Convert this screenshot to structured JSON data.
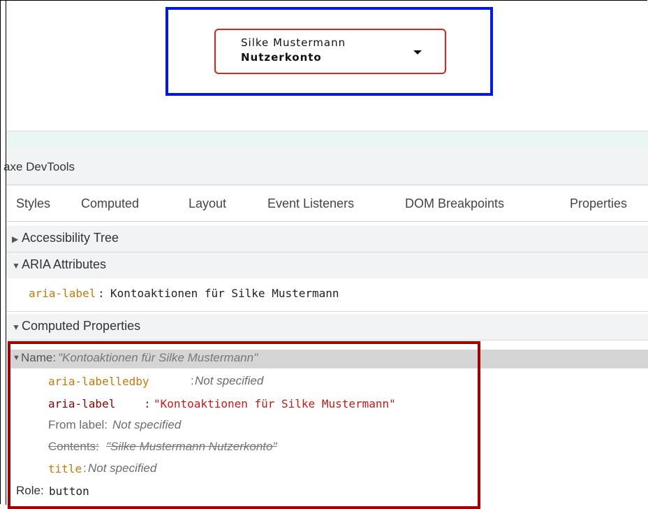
{
  "preview": {
    "account_name": "Silke Mustermann",
    "account_type": "Nutzerkonto"
  },
  "devtools": {
    "title": "axe DevTools",
    "tabs": [
      "Styles",
      "Computed",
      "Layout",
      "Event Listeners",
      "DOM Breakpoints",
      "Properties"
    ],
    "sections": {
      "accessibility_tree": "Accessibility Tree",
      "aria_attributes": "ARIA Attributes",
      "computed_properties": "Computed Properties"
    },
    "aria_attr": {
      "name": "aria-label",
      "value": "Kontoaktionen für Silke Mustermann"
    },
    "computed": {
      "name_label": "Name:",
      "name_value": "\"Kontoaktionen für Silke Mustermann\"",
      "labelledby_name": "aria-labelledby",
      "labelledby_value": "Not specified",
      "arialabel_name": "aria-label",
      "arialabel_value": "\"Kontoaktionen für Silke Mustermann\"",
      "from_label_name": "From label:",
      "from_label_value": "Not specified",
      "contents_name": "Contents:",
      "contents_value": "\"Silke Mustermann Nutzerkonto\"",
      "title_name": "title",
      "title_value": "Not specified",
      "role_name": "Role:",
      "role_value": "button"
    }
  },
  "colors": {
    "highlight_blue": "#0019e6",
    "highlight_red": "#e3201b",
    "highlight_darkred": "#a40000",
    "aria_attr": "#c7780a",
    "string_value": "#c41a16"
  }
}
